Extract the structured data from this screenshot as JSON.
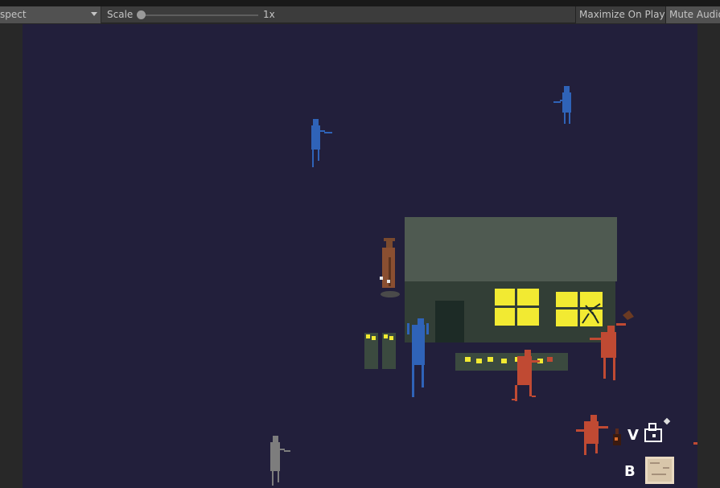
{
  "toolbar": {
    "aspect_label": "spect",
    "scale_label": "Scale",
    "scale_value": "1x",
    "maximize_label": "Maximize On Play",
    "mute_label": "Mute Audio"
  },
  "hud": {
    "key_v": "V",
    "key_b": "B"
  },
  "colors": {
    "background": "#221f3b",
    "house_roof": "#4f5a51",
    "house_wall": "#323e36",
    "window_light": "#f2ea32",
    "blue_figure": "#2f63b8",
    "red_figure": "#c04a33",
    "gray_figure": "#7d7d7d",
    "detective": "#8a4f31"
  }
}
